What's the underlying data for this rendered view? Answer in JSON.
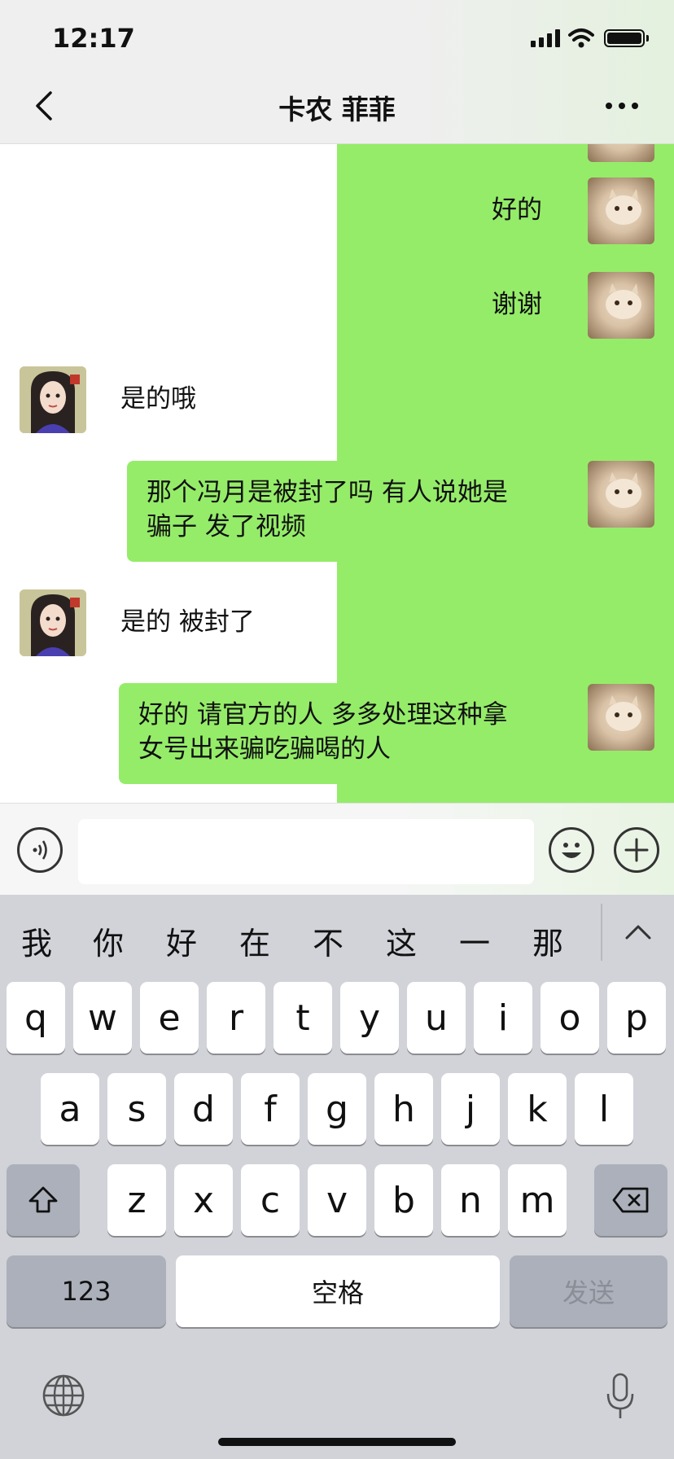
{
  "status_bar": {
    "time": "12:17"
  },
  "nav": {
    "title": "卡农 菲菲"
  },
  "messages": [
    {
      "side": "right",
      "text": "好的"
    },
    {
      "side": "right",
      "text": "谢谢"
    },
    {
      "side": "left",
      "text": "是的哦"
    },
    {
      "side": "right",
      "lines": [
        "那个冯月是被封了吗 有人说她是",
        "骗子 发了视频"
      ]
    },
    {
      "side": "left",
      "text": "是的 被封了"
    },
    {
      "side": "right",
      "lines": [
        "好的 请官方的人 多多处理这种拿",
        "女号出来骗吃骗喝的人"
      ]
    }
  ],
  "input": {
    "placeholder": ""
  },
  "keyboard": {
    "suggestions": [
      "我",
      "你",
      "好",
      "在",
      "不",
      "这",
      "一",
      "那"
    ],
    "row1": [
      "q",
      "w",
      "e",
      "r",
      "t",
      "y",
      "u",
      "i",
      "o",
      "p"
    ],
    "row2": [
      "a",
      "s",
      "d",
      "f",
      "g",
      "h",
      "j",
      "k",
      "l"
    ],
    "row3": [
      "z",
      "x",
      "c",
      "v",
      "b",
      "n",
      "m"
    ],
    "numbers_label": "123",
    "space_label": "空格",
    "send_label": "发送"
  },
  "icons": [
    "back-icon",
    "more-icon",
    "voice-icon",
    "emoji-icon",
    "plus-icon",
    "shift-icon",
    "backspace-icon",
    "globe-icon",
    "microphone-icon",
    "collapse-chevron-icon"
  ],
  "colors": {
    "bubble_green": "#95ec69",
    "keyboard_bg": "#d1d3d9",
    "send_text": "#8a8e96"
  }
}
